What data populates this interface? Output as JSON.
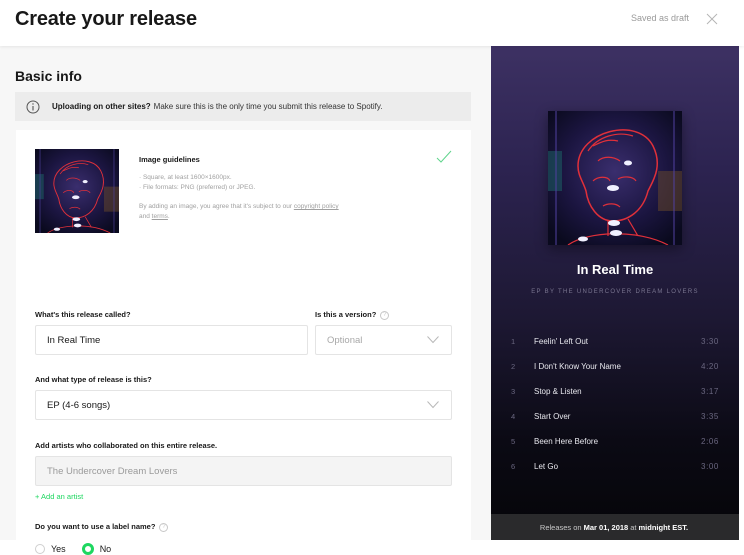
{
  "header": {
    "title": "Create your release",
    "status": "Saved as draft",
    "close_icon": "close-x-icon"
  },
  "form": {
    "section_title": "Basic info",
    "banner": {
      "icon": "info-circle-icon",
      "bold": "Uploading on other sites?",
      "text": "Make sure this is the only time you submit this release to Spotify."
    },
    "image": {
      "guidelines_title": "Image guidelines",
      "guidelines": [
        "· Square, at least 1600×1600px.",
        "· File formats: PNG (preferred) or JPEG."
      ],
      "note_prefix": "By adding an image, you agree that it's subject to our",
      "link_copyright": "copyright policy",
      "note_and": "and",
      "link_terms": "terms",
      "note_suffix": ".",
      "status_icon": "checkmark-icon"
    },
    "release_name": {
      "label": "What's this release called?",
      "value": "In Real Time"
    },
    "version": {
      "label": "Is this a version?",
      "placeholder": "Optional"
    },
    "release_type": {
      "label": "And what type of release is this?",
      "value": "EP (4-6 songs)"
    },
    "artists": {
      "label": "Add artists who collaborated on this entire release.",
      "value": "The Undercover Dream Lovers",
      "add_link": "+ Add an artist"
    },
    "label_name": {
      "label": "Do you want to use a label name?",
      "options": [
        "Yes",
        "No"
      ],
      "selected": "No"
    }
  },
  "preview": {
    "title": "In Real Time",
    "subtitle": "EP BY THE UNDERCOVER DREAM LOVERS",
    "tracks": [
      {
        "num": "1",
        "title": "Feelin' Left Out",
        "duration": "3:30"
      },
      {
        "num": "2",
        "title": "I Don't Know Your Name",
        "duration": "4:20"
      },
      {
        "num": "3",
        "title": "Stop & Listen",
        "duration": "3:17"
      },
      {
        "num": "4",
        "title": "Start Over",
        "duration": "3:35"
      },
      {
        "num": "5",
        "title": "Been Here Before",
        "duration": "2:06"
      },
      {
        "num": "6",
        "title": "Let Go",
        "duration": "3:00"
      }
    ],
    "release": {
      "prefix": "Releases on",
      "date": "Mar 01, 2018",
      "at": "at",
      "time": "midnight EST."
    }
  },
  "colors": {
    "accent": "#1ed760",
    "preview_bg_top": "#3d3163",
    "preview_bg_bottom": "#050508"
  }
}
